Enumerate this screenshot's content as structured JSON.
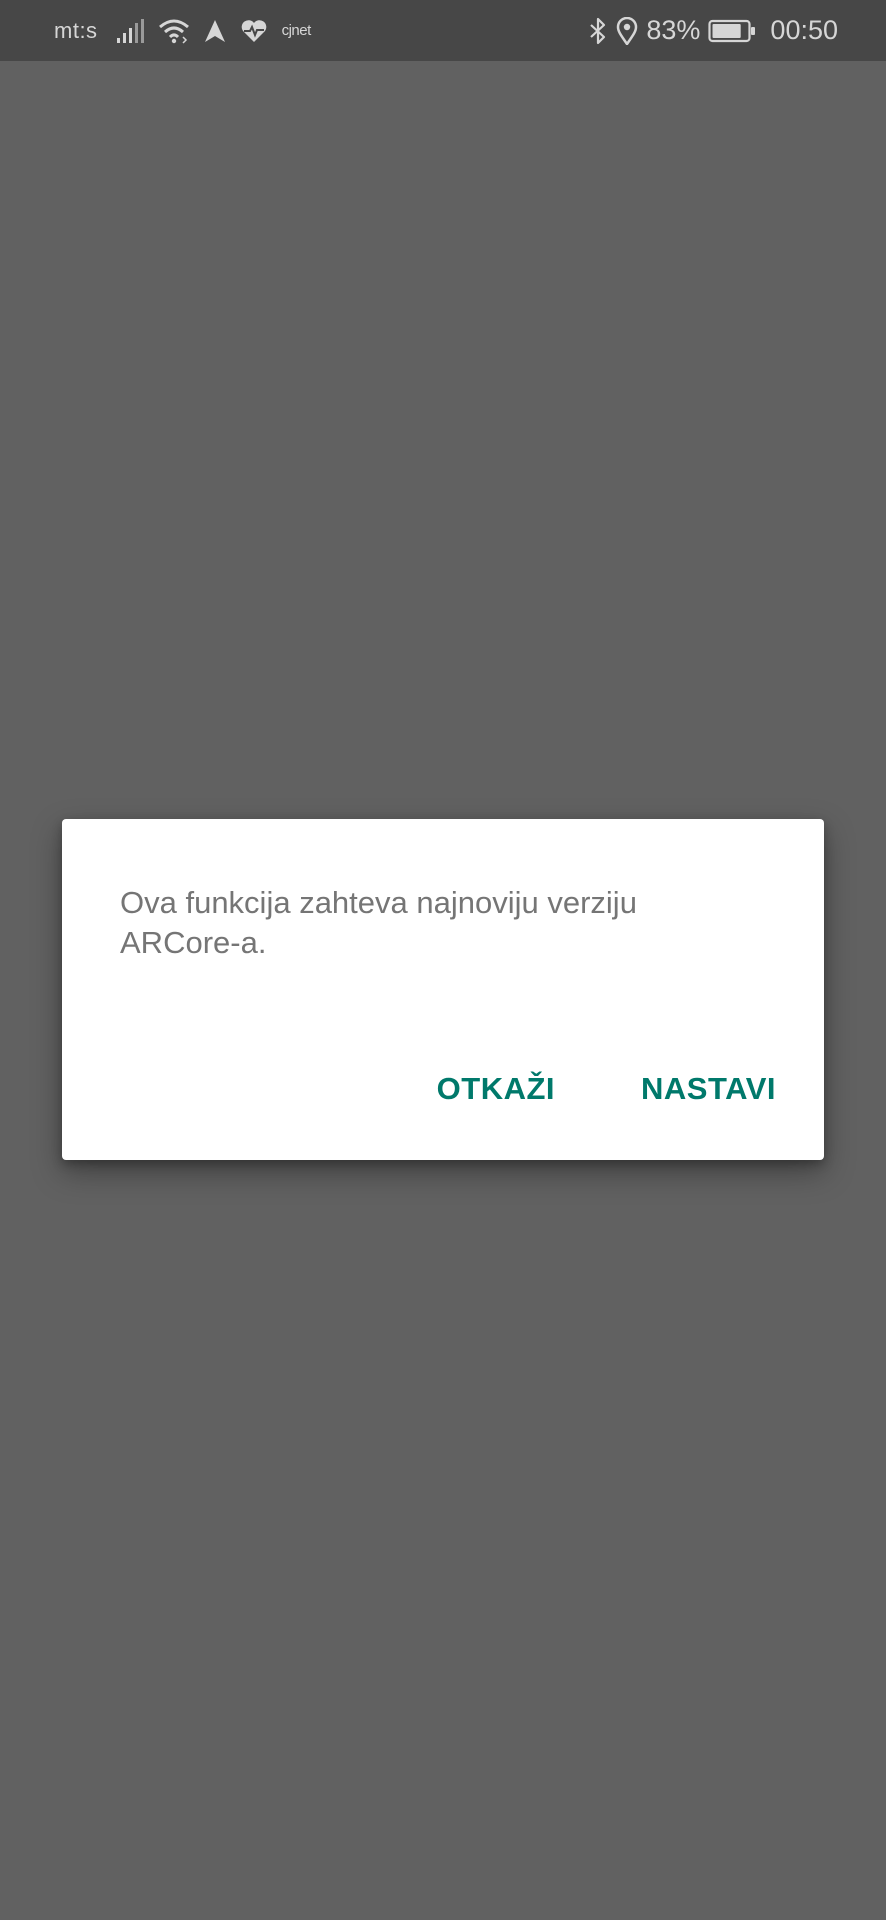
{
  "status_bar": {
    "carrier": "mt:s",
    "vpn_label": "cjnet",
    "battery_percent": "83%",
    "battery_level": 0.83,
    "time": "00:50",
    "icons": [
      "signal-icon",
      "wifi-icon",
      "navigation-icon",
      "health-heart-icon",
      "bluetooth-icon",
      "location-icon",
      "battery-icon"
    ]
  },
  "dialog": {
    "message": "Ova funkcija zahteva najnoviju verziju ARCore-a.",
    "cancel_label": "OTKAŽI",
    "continue_label": "NASTAVI",
    "accent_color": "#00796b"
  },
  "colors": {
    "scrim": "#616161",
    "status_bar_bg": "#474747",
    "dialog_bg": "#ffffff",
    "message_text": "#757575"
  }
}
